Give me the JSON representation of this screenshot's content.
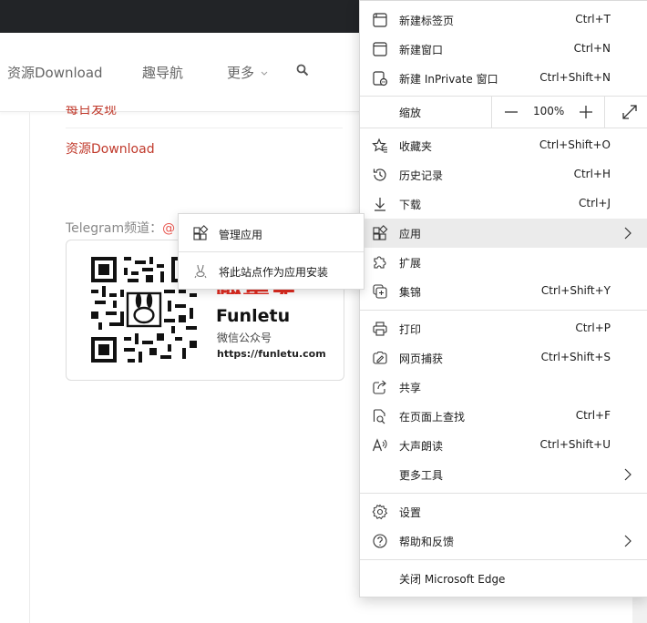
{
  "nav": {
    "items": [
      "资源Download",
      "趣导航",
      "更多"
    ]
  },
  "content": {
    "link_partial": "每日发现",
    "link_download": "资源Download",
    "telegram_label": "Telegram频道：",
    "telegram_at": "@",
    "card": {
      "brand_red": "趣集免",
      "brand_name": "Funletu",
      "brand_sub": "微信公众号",
      "brand_url": "https://funletu.com"
    }
  },
  "menu": {
    "new_tab": {
      "label": "新建标签页",
      "shortcut": "Ctrl+T",
      "icon": "new-tab-icon"
    },
    "new_window": {
      "label": "新建窗口",
      "shortcut": "Ctrl+N",
      "icon": "window-icon"
    },
    "new_private": {
      "label": "新建 InPrivate 窗口",
      "shortcut": "Ctrl+Shift+N",
      "icon": "inprivate-icon"
    },
    "zoom": {
      "label": "缩放",
      "value": "100%"
    },
    "favorites": {
      "label": "收藏夹",
      "shortcut": "Ctrl+Shift+O",
      "icon": "star-icon"
    },
    "history": {
      "label": "历史记录",
      "shortcut": "Ctrl+H",
      "icon": "history-icon"
    },
    "downloads": {
      "label": "下载",
      "shortcut": "Ctrl+J",
      "icon": "download-icon"
    },
    "apps": {
      "label": "应用",
      "icon": "apps-icon"
    },
    "extensions": {
      "label": "扩展",
      "icon": "puzzle-icon"
    },
    "collections": {
      "label": "集锦",
      "shortcut": "Ctrl+Shift+Y",
      "icon": "collections-icon"
    },
    "print": {
      "label": "打印",
      "shortcut": "Ctrl+P",
      "icon": "printer-icon"
    },
    "capture": {
      "label": "网页捕获",
      "shortcut": "Ctrl+Shift+S",
      "icon": "capture-icon"
    },
    "share": {
      "label": "共享",
      "icon": "share-icon"
    },
    "find": {
      "label": "在页面上查找",
      "shortcut": "Ctrl+F",
      "icon": "find-icon"
    },
    "read_aloud": {
      "label": "大声朗读",
      "shortcut": "Ctrl+Shift+U",
      "icon": "read-aloud-icon"
    },
    "more_tools": {
      "label": "更多工具"
    },
    "settings": {
      "label": "设置",
      "icon": "gear-icon"
    },
    "help": {
      "label": "帮助和反馈",
      "icon": "help-icon"
    },
    "close": {
      "label": "关闭 Microsoft Edge"
    }
  },
  "submenu": {
    "manage_apps": {
      "label": "管理应用",
      "icon": "apps-icon"
    },
    "install_site": {
      "label": "将此站点作为应用安装",
      "icon": "install-app-icon"
    }
  },
  "colors": {
    "accent_red": "#c0392b",
    "highlight": "#ebebeb",
    "topbar": "#222427"
  }
}
